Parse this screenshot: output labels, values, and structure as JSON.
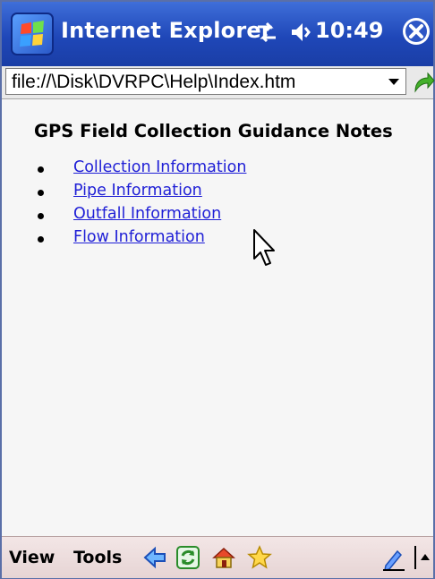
{
  "titlebar": {
    "app_title": "Internet Explorer",
    "time": "10:49",
    "icons": [
      "windows-start-icon",
      "connectivity-icon",
      "volume-icon",
      "close-icon"
    ]
  },
  "addressbar": {
    "url": "file://\\Disk\\DVRPC\\Help\\Index.htm",
    "icons": [
      "dropdown-arrow-icon",
      "go-arrow-icon"
    ]
  },
  "content": {
    "heading": "GPS Field Collection Guidance Notes",
    "links": [
      {
        "label": "Collection Information"
      },
      {
        "label": "Pipe Information"
      },
      {
        "label": "Outfall Information"
      },
      {
        "label": "Flow Information"
      }
    ]
  },
  "cmdbar": {
    "view_label": "View",
    "tools_label": "Tools",
    "icons": [
      "back-icon",
      "refresh-icon",
      "home-icon",
      "favorites-icon",
      "input-panel-icon",
      "input-arrow-icon"
    ]
  },
  "colors": {
    "titlebar": "#1f47b8",
    "link": "#1f1fd6",
    "cmdbar": "#e9d8d8"
  }
}
